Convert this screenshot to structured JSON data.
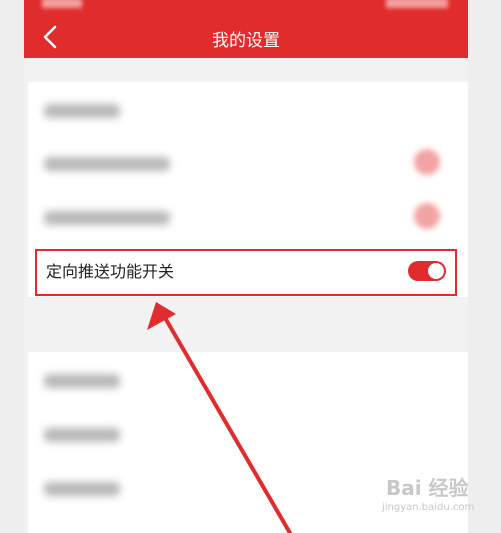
{
  "appbar": {
    "title": "我的设置",
    "back_icon": "chevron-left-icon"
  },
  "settings": {
    "highlighted_item": {
      "label": "定向推送功能开关",
      "toggle_on": true,
      "toggle_color": "#e02c2c"
    }
  },
  "colors": {
    "accent": "#e02c2c",
    "background": "#f2f2f2"
  },
  "watermark": {
    "brand": "Bai 经验",
    "url": "jingyan.baidu.com"
  }
}
